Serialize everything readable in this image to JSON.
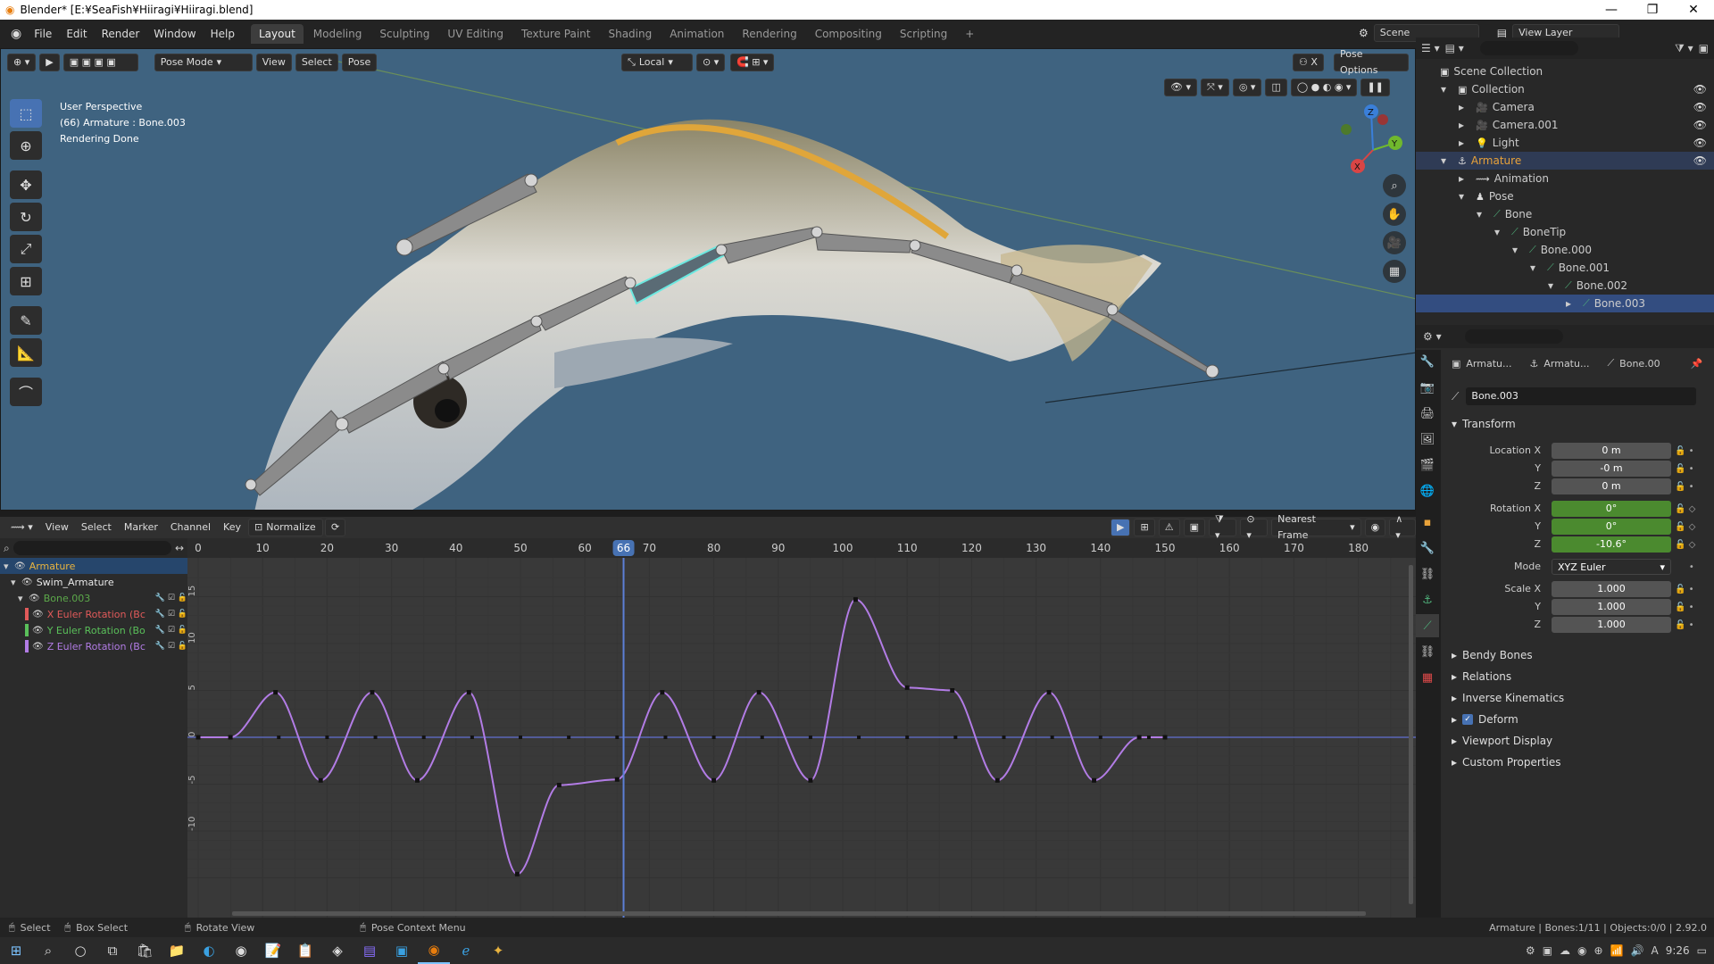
{
  "window": {
    "title": "Blender* [E:¥SeaFish¥Hiiragi¥Hiiragi.blend]",
    "minimize": "—",
    "maximize": "❐",
    "close": "✕"
  },
  "menus": [
    "File",
    "Edit",
    "Render",
    "Window",
    "Help"
  ],
  "workspaces": [
    "Layout",
    "Modeling",
    "Sculpting",
    "UV Editing",
    "Texture Paint",
    "Shading",
    "Animation",
    "Rendering",
    "Compositing",
    "Scripting"
  ],
  "workspace_add": "+",
  "scene": {
    "label": "Scene",
    "view_layer": "View Layer"
  },
  "viewport": {
    "mode": "Pose Mode",
    "menus": [
      "View",
      "Select",
      "Pose"
    ],
    "orientation": "Local",
    "pose_options": "Pose Options",
    "overlay_lines": [
      "User Perspective",
      "(66) Armature : Bone.003",
      "Rendering Done"
    ],
    "gizmo": {
      "x": "X",
      "y": "Y",
      "z": "Z"
    }
  },
  "graph_editor": {
    "menus": [
      "View",
      "Select",
      "Marker",
      "Channel",
      "Key"
    ],
    "normalize": "Normalize",
    "snap": "Nearest Frame",
    "current_frame": "66",
    "frame_ticks": [
      "0",
      "10",
      "20",
      "30",
      "40",
      "50",
      "60",
      "70",
      "80",
      "90",
      "100",
      "110",
      "120",
      "130",
      "140",
      "150",
      "160",
      "170",
      "180"
    ],
    "value_ticks": [
      "15",
      "10",
      "5",
      "0",
      "-5",
      "-10"
    ],
    "channels": [
      {
        "label": "Armature",
        "color": "#e8b33f",
        "level": 0
      },
      {
        "label": "Swim_Armature",
        "color": "#e8e8e8",
        "level": 1
      },
      {
        "label": "Bone.003",
        "color": "#5ca94a",
        "level": 2
      },
      {
        "label": "X Euler Rotation (Bc",
        "color": "#e15a5a",
        "level": 3
      },
      {
        "label": "Y Euler Rotation (Bo",
        "color": "#5ac05a",
        "level": 3
      },
      {
        "label": "Z Euler Rotation (Bc",
        "color": "#b27ce5",
        "level": 3
      }
    ]
  },
  "outliner": {
    "rows": [
      {
        "label": "Scene Collection",
        "indent": 0,
        "icon": "▣"
      },
      {
        "label": "Collection",
        "indent": 1,
        "icon": "▣"
      },
      {
        "label": "Camera",
        "indent": 2,
        "icon": "🎥"
      },
      {
        "label": "Camera.001",
        "indent": 2,
        "icon": "🎥"
      },
      {
        "label": "Light",
        "indent": 2,
        "icon": "💡"
      },
      {
        "label": "Armature",
        "indent": 1,
        "icon": "⚓"
      },
      {
        "label": "Animation",
        "indent": 2,
        "icon": "⟿"
      },
      {
        "label": "Pose",
        "indent": 2,
        "icon": "♟"
      },
      {
        "label": "Bone",
        "indent": 3,
        "icon": "⟋"
      },
      {
        "label": "BoneTip",
        "indent": 4,
        "icon": "⟋"
      },
      {
        "label": "Bone.000",
        "indent": 5,
        "icon": "⟋"
      },
      {
        "label": "Bone.001",
        "indent": 6,
        "icon": "⟋"
      },
      {
        "label": "Bone.002",
        "indent": 7,
        "icon": "⟋"
      },
      {
        "label": "Bone.003",
        "indent": 8,
        "icon": "⟋"
      }
    ]
  },
  "properties": {
    "breadcrumb": [
      "Armatu...",
      "Armatu...",
      "Bone.00"
    ],
    "bone_name": "Bone.003",
    "transform": "Transform",
    "location_label": "Location X",
    "location": [
      "0 m",
      "-0 m",
      "0 m"
    ],
    "rotation_label": "Rotation X",
    "rotation": [
      "0°",
      "0°",
      "-10.6°"
    ],
    "mode_label": "Mode",
    "mode": "XYZ Euler",
    "scale_label": "Scale X",
    "scale": [
      "1.000",
      "1.000",
      "1.000"
    ],
    "axis_y": "Y",
    "axis_z": "Z",
    "sections": [
      "Bendy Bones",
      "Relations",
      "Inverse Kinematics",
      "Deform",
      "Viewport Display",
      "Custom Properties"
    ]
  },
  "status": {
    "select": "Select",
    "box_select": "Box Select",
    "rotate": "Rotate View",
    "context": "Pose Context Menu",
    "info": "Armature | Bones:1/11 | Objects:0/0 | 2.92.0"
  },
  "taskbar": {
    "time": "9:26"
  }
}
